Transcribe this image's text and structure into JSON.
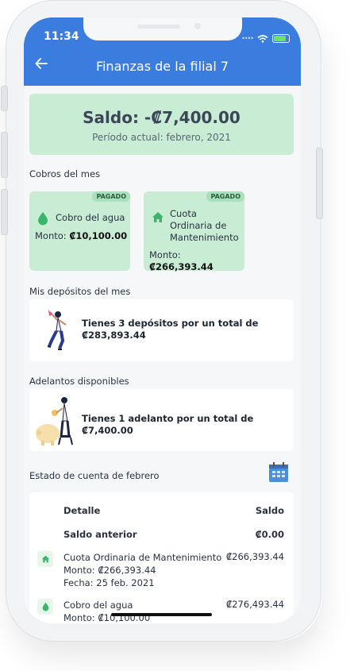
{
  "status": {
    "time": "11:34"
  },
  "header": {
    "title": "Finanzas de la filial 7"
  },
  "balance": {
    "amount": "Saldo: -₡7,400.00",
    "period": "Período actual: febrero, 2021"
  },
  "charges": {
    "section_title": "Cobros del mes",
    "items": [
      {
        "badge": "PAGADO",
        "name": "Cobro del agua",
        "monto_label": "Monto:",
        "monto_value": "₡10,100.00",
        "icon": "water-drop-icon"
      },
      {
        "badge": "PAGADO",
        "name": "Cuota Ordinaria de Mantenimiento",
        "monto_label": "Monto:",
        "monto_value": "₡266,393.44",
        "icon": "home-icon"
      }
    ]
  },
  "deposits": {
    "section_title": "Mis depósitos del mes",
    "text": "Tienes 3 depósitos por un total de ₡283,893.44"
  },
  "advances": {
    "section_title": "Adelantos disponibles",
    "text": "Tienes 1 adelanto por un total de ₡7,400.00"
  },
  "statement": {
    "section_title": "Estado de cuenta de febrero",
    "header": {
      "detail": "Detalle",
      "balance": "Saldo"
    },
    "previous": {
      "label": "Saldo anterior",
      "value": "₡0.00"
    },
    "rows": [
      {
        "icon": "home-icon",
        "title": "Cuota Ordinaria de Mantenimiento",
        "monto": "Monto: ₡266,393.44",
        "fecha": "Fecha: 25 feb. 2021",
        "saldo": "₡266,393.44"
      },
      {
        "icon": "water-drop-icon",
        "title": "Cobro del agua",
        "monto": "Monto: ₡10,100.00",
        "saldo": "₡276,493.44"
      }
    ]
  },
  "colors": {
    "header": "#3a7dde",
    "mint": "#c9ecd5",
    "badge": "#a8e0bc",
    "green_icon": "#3bb56b"
  }
}
